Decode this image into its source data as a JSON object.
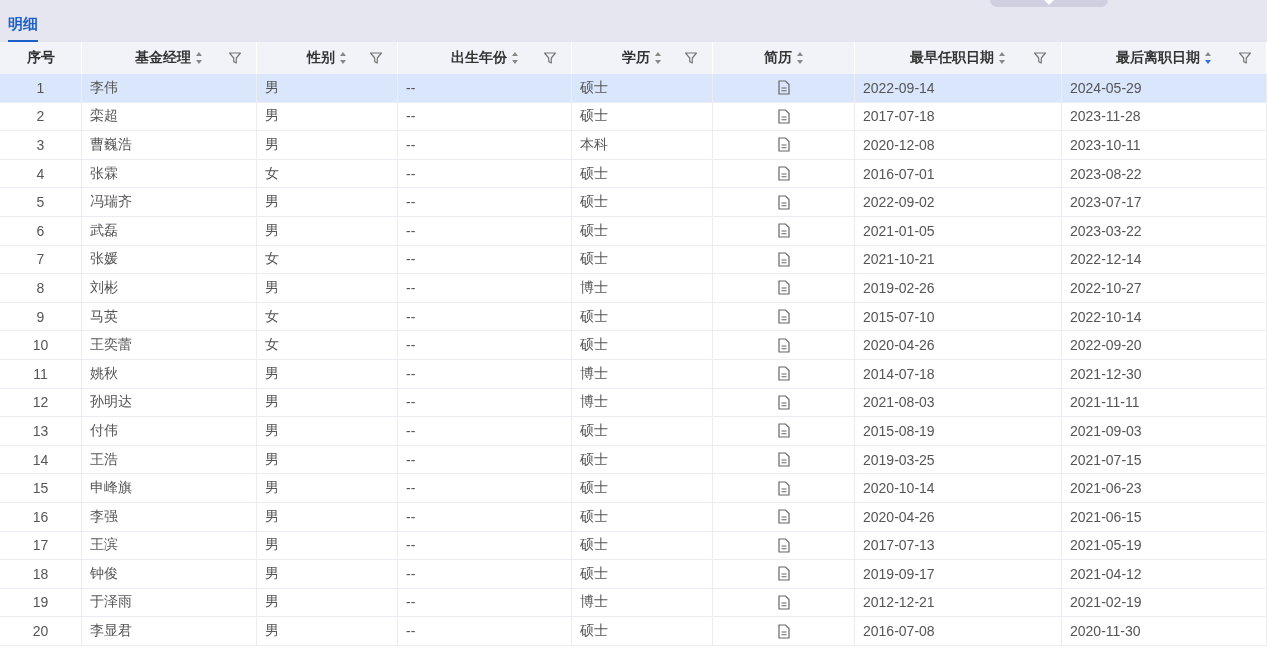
{
  "tabs": [
    {
      "label": "明细",
      "selected": true
    }
  ],
  "table": {
    "columns": [
      {
        "label": "序号",
        "sortable": false,
        "filterable": false
      },
      {
        "label": "基金经理",
        "sortable": true,
        "sort_descending": false,
        "filterable": true
      },
      {
        "label": "性别",
        "sortable": true,
        "sort_descending": false,
        "filterable": true
      },
      {
        "label": "出生年份",
        "sortable": true,
        "sort_descending": false,
        "filterable": true
      },
      {
        "label": "学历",
        "sortable": true,
        "sort_descending": false,
        "filterable": true
      },
      {
        "label": "简历",
        "sortable": true,
        "sort_descending": false,
        "filterable": false
      },
      {
        "label": "最早任职日期",
        "sortable": true,
        "sort_descending": false,
        "filterable": true
      },
      {
        "label": "最后离职日期",
        "sortable": true,
        "sort_descending": true,
        "filterable": true
      }
    ],
    "rows": [
      {
        "index": "1",
        "name": "李伟",
        "gender": "男",
        "birth_year": "--",
        "education": "硕士",
        "start": "2022-09-14",
        "end": "2024-05-29",
        "selected": true
      },
      {
        "index": "2",
        "name": "栾超",
        "gender": "男",
        "birth_year": "--",
        "education": "硕士",
        "start": "2017-07-18",
        "end": "2023-11-28",
        "selected": false
      },
      {
        "index": "3",
        "name": "曹巍浩",
        "gender": "男",
        "birth_year": "--",
        "education": "本科",
        "start": "2020-12-08",
        "end": "2023-10-11",
        "selected": false
      },
      {
        "index": "4",
        "name": "张霖",
        "gender": "女",
        "birth_year": "--",
        "education": "硕士",
        "start": "2016-07-01",
        "end": "2023-08-22",
        "selected": false
      },
      {
        "index": "5",
        "name": "冯瑞齐",
        "gender": "男",
        "birth_year": "--",
        "education": "硕士",
        "start": "2022-09-02",
        "end": "2023-07-17",
        "selected": false
      },
      {
        "index": "6",
        "name": "武磊",
        "gender": "男",
        "birth_year": "--",
        "education": "硕士",
        "start": "2021-01-05",
        "end": "2023-03-22",
        "selected": false
      },
      {
        "index": "7",
        "name": "张媛",
        "gender": "女",
        "birth_year": "--",
        "education": "硕士",
        "start": "2021-10-21",
        "end": "2022-12-14",
        "selected": false
      },
      {
        "index": "8",
        "name": "刘彬",
        "gender": "男",
        "birth_year": "--",
        "education": "博士",
        "start": "2019-02-26",
        "end": "2022-10-27",
        "selected": false
      },
      {
        "index": "9",
        "name": "马英",
        "gender": "女",
        "birth_year": "--",
        "education": "硕士",
        "start": "2015-07-10",
        "end": "2022-10-14",
        "selected": false
      },
      {
        "index": "10",
        "name": "王奕蕾",
        "gender": "女",
        "birth_year": "--",
        "education": "硕士",
        "start": "2020-04-26",
        "end": "2022-09-20",
        "selected": false
      },
      {
        "index": "11",
        "name": "姚秋",
        "gender": "男",
        "birth_year": "--",
        "education": "博士",
        "start": "2014-07-18",
        "end": "2021-12-30",
        "selected": false
      },
      {
        "index": "12",
        "name": "孙明达",
        "gender": "男",
        "birth_year": "--",
        "education": "博士",
        "start": "2021-08-03",
        "end": "2021-11-11",
        "selected": false
      },
      {
        "index": "13",
        "name": "付伟",
        "gender": "男",
        "birth_year": "--",
        "education": "硕士",
        "start": "2015-08-19",
        "end": "2021-09-03",
        "selected": false
      },
      {
        "index": "14",
        "name": "王浩",
        "gender": "男",
        "birth_year": "--",
        "education": "硕士",
        "start": "2019-03-25",
        "end": "2021-07-15",
        "selected": false
      },
      {
        "index": "15",
        "name": "申峰旗",
        "gender": "男",
        "birth_year": "--",
        "education": "硕士",
        "start": "2020-10-14",
        "end": "2021-06-23",
        "selected": false
      },
      {
        "index": "16",
        "name": "李强",
        "gender": "男",
        "birth_year": "--",
        "education": "硕士",
        "start": "2020-04-26",
        "end": "2021-06-15",
        "selected": false
      },
      {
        "index": "17",
        "name": "王滨",
        "gender": "男",
        "birth_year": "--",
        "education": "硕士",
        "start": "2017-07-13",
        "end": "2021-05-19",
        "selected": false
      },
      {
        "index": "18",
        "name": "钟俊",
        "gender": "男",
        "birth_year": "--",
        "education": "硕士",
        "start": "2019-09-17",
        "end": "2021-04-12",
        "selected": false
      },
      {
        "index": "19",
        "name": "于泽雨",
        "gender": "男",
        "birth_year": "--",
        "education": "博士",
        "start": "2012-12-21",
        "end": "2021-02-19",
        "selected": false
      },
      {
        "index": "20",
        "name": "李显君",
        "gender": "男",
        "birth_year": "--",
        "education": "硕士",
        "start": "2016-07-08",
        "end": "2020-11-30",
        "selected": false
      }
    ]
  }
}
